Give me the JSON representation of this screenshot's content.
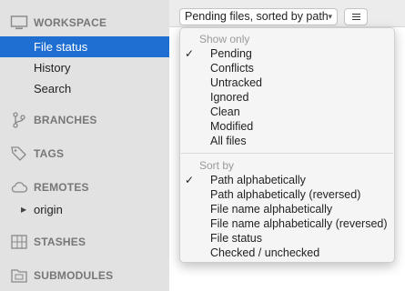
{
  "sidebar": {
    "workspace": {
      "header": "WORKSPACE",
      "icon": "monitor-icon",
      "items": [
        {
          "label": "File status",
          "selected": true
        },
        {
          "label": "History",
          "selected": false
        },
        {
          "label": "Search",
          "selected": false
        }
      ]
    },
    "branches": {
      "header": "BRANCHES",
      "icon": "branch-icon"
    },
    "tags": {
      "header": "TAGS",
      "icon": "tag-icon"
    },
    "remotes": {
      "header": "REMOTES",
      "icon": "cloud-icon",
      "items": [
        {
          "label": "origin",
          "expanded": false
        }
      ]
    },
    "stashes": {
      "header": "STASHES",
      "icon": "stash-icon"
    },
    "submodules": {
      "header": "SUBMODULES",
      "icon": "folder-icon"
    }
  },
  "toolbar": {
    "filter_popup": {
      "label": "Pending files, sorted by path",
      "icon": "chevron-down-icon"
    },
    "view_button": {
      "icon": "list-icon"
    }
  },
  "menu": {
    "show_only": {
      "header": "Show only",
      "items": [
        {
          "label": "Pending",
          "checked": true
        },
        {
          "label": "Conflicts",
          "checked": false
        },
        {
          "label": "Untracked",
          "checked": false
        },
        {
          "label": "Ignored",
          "checked": false
        },
        {
          "label": "Clean",
          "checked": false
        },
        {
          "label": "Modified",
          "checked": false
        },
        {
          "label": "All files",
          "checked": false
        }
      ]
    },
    "sort_by": {
      "header": "Sort by",
      "items": [
        {
          "label": "Path alphabetically",
          "checked": true
        },
        {
          "label": "Path alphabetically (reversed)",
          "checked": false
        },
        {
          "label": "File name alphabetically",
          "checked": false
        },
        {
          "label": "File name alphabetically (reversed)",
          "checked": false
        },
        {
          "label": "File status",
          "checked": false
        },
        {
          "label": "Checked / unchecked",
          "checked": false
        }
      ]
    },
    "check_glyph": "✓"
  },
  "colors": {
    "selection": "#1f6fd2",
    "sidebar_bg": "#e2e2e2",
    "menu_bg": "#f5f5f5"
  }
}
